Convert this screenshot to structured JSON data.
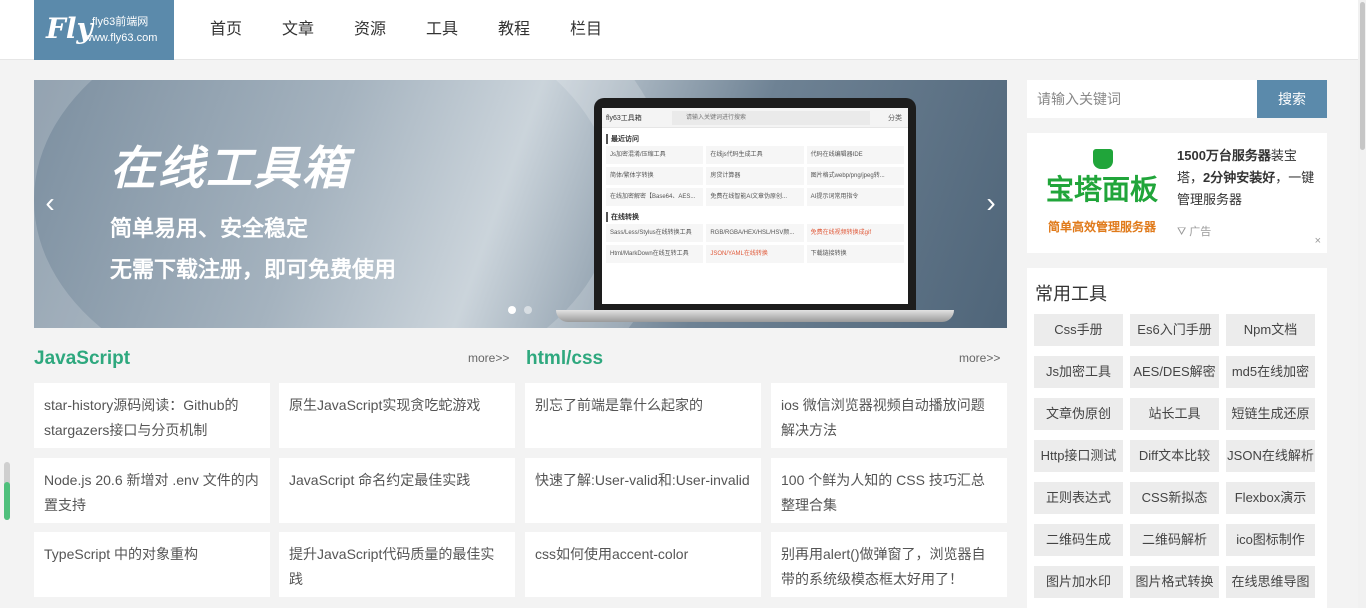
{
  "logo": {
    "mark": "Fly",
    "line1": "fly63前端网",
    "line2": "www.fly63.com"
  },
  "nav": [
    "首页",
    "文章",
    "资源",
    "工具",
    "教程",
    "栏目"
  ],
  "banner": {
    "title": "在线工具箱",
    "line1": "简单易用、安全稳定",
    "line2": "无需下载注册，即可免费使用",
    "prev_icon": "‹",
    "next_icon": "›",
    "screen": {
      "brand": "fly63工具箱",
      "search_placeholder": "请输入关键词进行搜索",
      "category": "分类",
      "section1": "最近访问",
      "items1": [
        "Js加密混淆/压缩工具",
        "在线js代码生成工具",
        "代码在线编辑器IDE",
        "简体/繁体字转换",
        "房贷计算器",
        "图片格式webp/png/jpeg转...",
        "在线加密解密【Base64、AES...",
        "免费在线智能AI文章伪原创...",
        "AI提示词常用指令"
      ],
      "section2": "在线转换",
      "items2": [
        "Sass/Less/Stylus在线转换工具",
        "RGB/RGBA/HEX/HSL/HSV颜...",
        "免费在线视频转换成gif",
        "Html/MarkDown在线互转工具",
        "JSON/YAML在线转换",
        "下载链接转换"
      ]
    }
  },
  "sections": [
    {
      "title": "JavaScript",
      "more": "more>>"
    },
    {
      "title": "html/css",
      "more": "more>>"
    }
  ],
  "articles": {
    "js_left": [
      "star-history源码阅读：Github的stargazers接口与分页机制",
      "Node.js 20.6 新增对 .env 文件的内置支持",
      "TypeScript 中的对象重构"
    ],
    "js_right": [
      "原生JavaScript实现贪吃蛇游戏",
      "JavaScript 命名约定最佳实践",
      "提升JavaScript代码质量的最佳实践"
    ],
    "css_left": [
      "别忘了前端是靠什么起家的",
      "快速了解:User-valid和:User-invalid",
      "css如何使用accent-color"
    ],
    "css_right": [
      "ios 微信浏览器视频自动播放问题解决方法",
      "100 个鲜为人知的 CSS 技巧汇总整理合集",
      "别再用alert()做弹窗了，浏览器自带的系统级模态框太好用了！"
    ]
  },
  "search": {
    "placeholder": "请输入关键词",
    "button": "搜索"
  },
  "ad": {
    "brand": "宝塔面板",
    "slogan": "简单高效管理服务器",
    "text_bold1": "1500万台服务器",
    "text_mid": "装宝塔，",
    "text_bold2": "2分钟安装好",
    "text_end": "，一键管理服务器",
    "flag": "广告",
    "close": "×"
  },
  "tools": {
    "title": "常用工具",
    "items": [
      "Css手册",
      "Es6入门手册",
      "Npm文档",
      "Js加密工具",
      "AES/DES解密",
      "md5在线加密",
      "文章伪原创",
      "站长工具",
      "短链生成还原",
      "Http接口测试",
      "Diff文本比较",
      "JSON在线解析",
      "正则表达式",
      "CSS新拟态",
      "Flexbox演示",
      "二维码生成",
      "二维码解析",
      "ico图标制作",
      "图片加水印",
      "图片格式转换",
      "在线思维导图"
    ]
  }
}
